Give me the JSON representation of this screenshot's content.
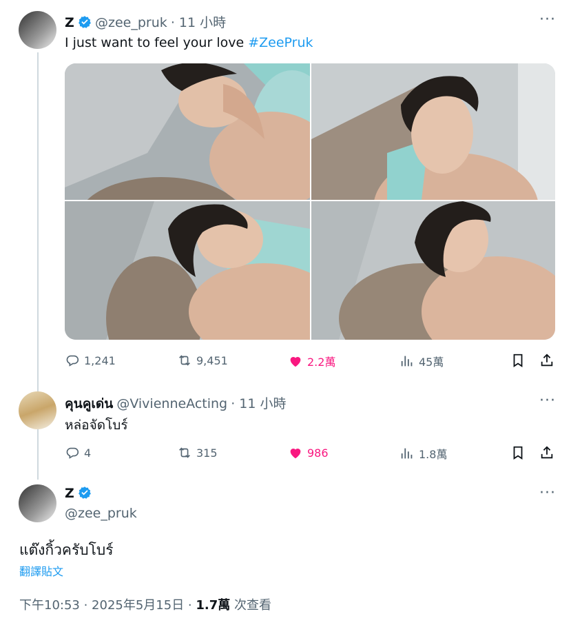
{
  "tweet1": {
    "name": "Z",
    "handle": "@zee_pruk",
    "time": "· 11 小時",
    "text": "I just want to feel your love ",
    "hashtag": "#ZeePruk",
    "stats": {
      "replies": "1,241",
      "retweets": "9,451",
      "likes": "2.2萬",
      "views": "45萬"
    }
  },
  "reply": {
    "name": "คุนคูเด่น",
    "handle": "@VivienneActing",
    "time": "· 11 小時",
    "text": "หล่อจัดโบร์",
    "stats": {
      "replies": "4",
      "retweets": "315",
      "likes": "986",
      "views": "1.8萬"
    }
  },
  "main": {
    "name": "Z",
    "handle": "@zee_pruk",
    "text": "แต๊งกิ้วครับโบร์",
    "translate": "翻譯貼文",
    "timestamp": "下午10:53 · 2025年5月15日 · ",
    "views_count": "1.7萬",
    "views_label": " 次查看"
  },
  "colors": {
    "accent": "#1d9bf0",
    "like": "#f91880",
    "muted": "#536471"
  },
  "icons": [
    "verified-badge-icon",
    "more-icon",
    "reply-icon",
    "retweet-icon",
    "like-icon",
    "views-icon",
    "bookmark-icon",
    "share-icon"
  ]
}
